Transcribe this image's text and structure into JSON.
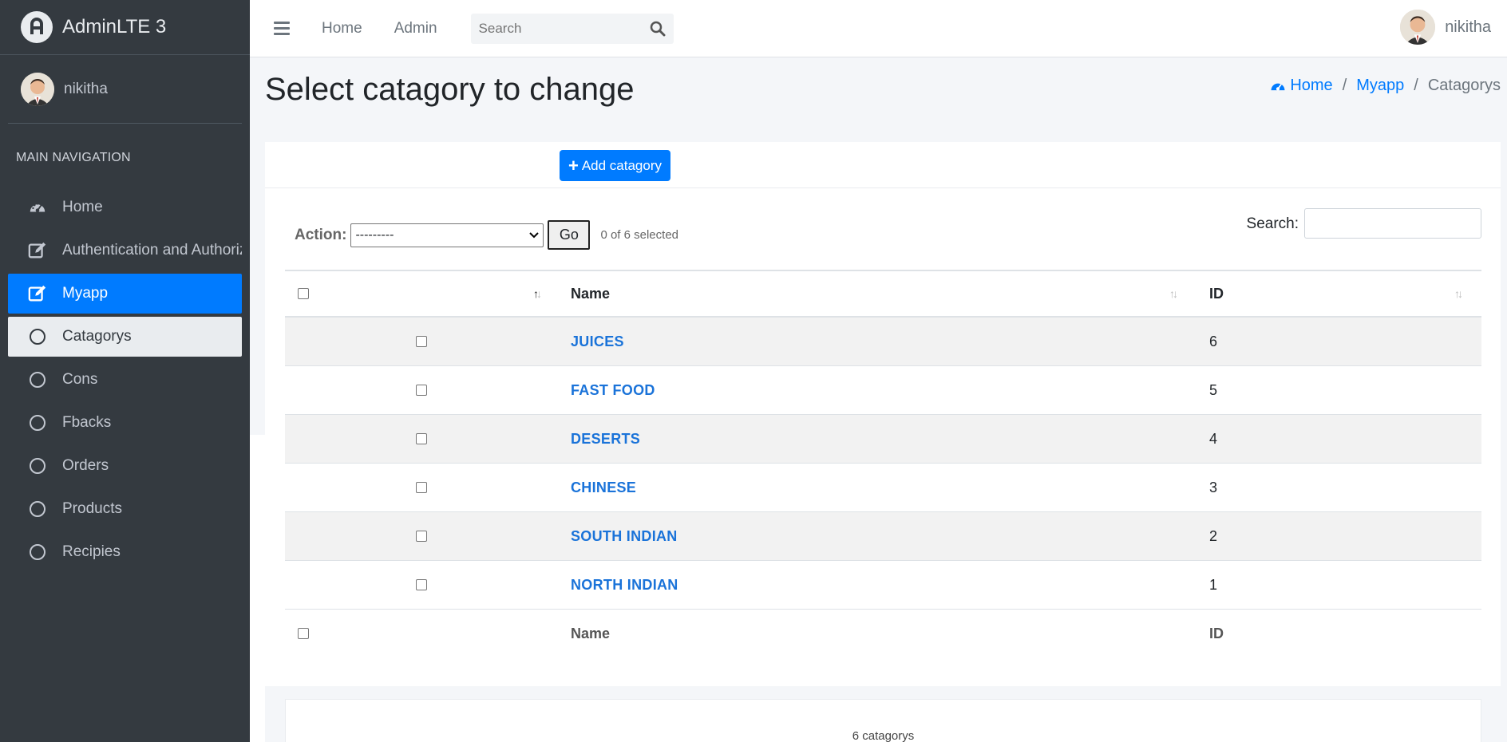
{
  "brand": {
    "name": "AdminLTE 3"
  },
  "sidebar": {
    "user": "nikitha",
    "header": "MAIN NAVIGATION",
    "items": [
      {
        "label": "Home",
        "icon": "dashboard-icon"
      },
      {
        "label": "Authentication and Authoriz",
        "icon": "edit-icon"
      },
      {
        "label": "Myapp",
        "icon": "edit-icon"
      },
      {
        "label": "Catagorys",
        "icon": "circle-icon"
      },
      {
        "label": "Cons",
        "icon": "circle-icon"
      },
      {
        "label": "Fbacks",
        "icon": "circle-icon"
      },
      {
        "label": "Orders",
        "icon": "circle-icon"
      },
      {
        "label": "Products",
        "icon": "circle-icon"
      },
      {
        "label": "Recipies",
        "icon": "circle-icon"
      }
    ]
  },
  "topbar": {
    "links": [
      "Home",
      "Admin"
    ],
    "search_placeholder": "Search",
    "user": "nikitha"
  },
  "page": {
    "title": "Select catagory to change",
    "breadcrumb": [
      "Home",
      "Myapp",
      "Catagorys"
    ],
    "add_button": "Add catagory"
  },
  "changelist": {
    "action_label": "Action:",
    "action_selected": "---------",
    "go_label": "Go",
    "selected_count": "0 of 6 selected",
    "search_label": "Search:",
    "columns": [
      "Name",
      "ID"
    ],
    "rows": [
      {
        "name": "JUICES",
        "id": "6"
      },
      {
        "name": "FAST FOOD",
        "id": "5"
      },
      {
        "name": "DESERTS",
        "id": "4"
      },
      {
        "name": "CHINESE",
        "id": "3"
      },
      {
        "name": "SOUTH INDIAN",
        "id": "2"
      },
      {
        "name": "NORTH INDIAN",
        "id": "1"
      }
    ],
    "footer_count": "6 catagorys"
  },
  "colors": {
    "sidebar_bg": "#343a40",
    "accent": "#007bff",
    "link": "#1a73d9"
  }
}
